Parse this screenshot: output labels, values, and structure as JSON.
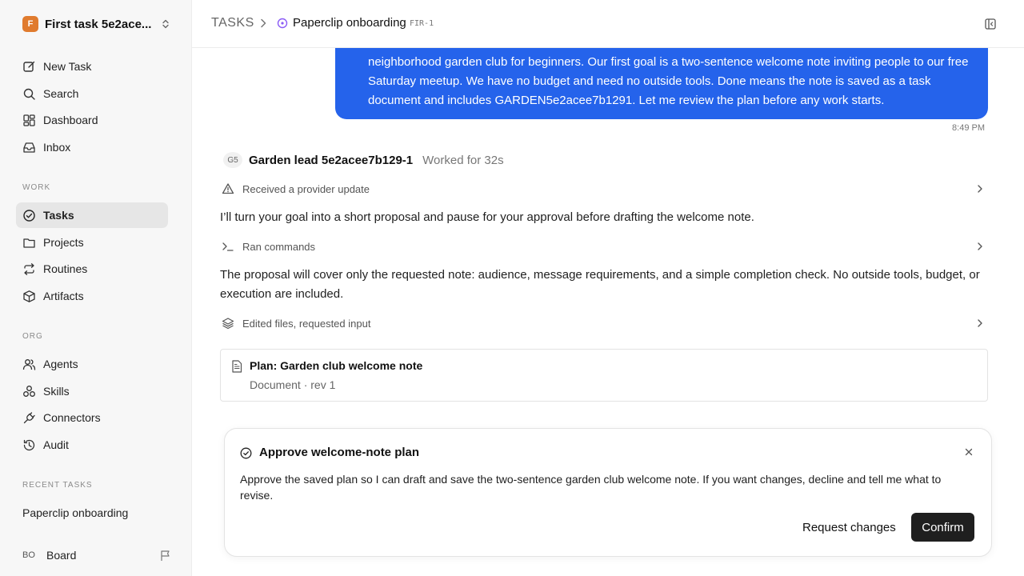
{
  "sidebar": {
    "workspace": {
      "initial": "F",
      "name": "First task 5e2ace..."
    },
    "top_items": [
      {
        "label": "New Task",
        "icon": "edit-icon"
      },
      {
        "label": "Search",
        "icon": "search-icon"
      },
      {
        "label": "Dashboard",
        "icon": "dashboard-icon"
      },
      {
        "label": "Inbox",
        "icon": "inbox-icon"
      }
    ],
    "work_label": "WORK",
    "work_items": [
      {
        "label": "Tasks",
        "icon": "check-circle-icon",
        "active": true
      },
      {
        "label": "Projects",
        "icon": "folder-icon"
      },
      {
        "label": "Routines",
        "icon": "repeat-icon"
      },
      {
        "label": "Artifacts",
        "icon": "box-icon"
      }
    ],
    "org_label": "ORG",
    "org_items": [
      {
        "label": "Agents",
        "icon": "users-icon"
      },
      {
        "label": "Skills",
        "icon": "skills-icon"
      },
      {
        "label": "Connectors",
        "icon": "plug-icon"
      },
      {
        "label": "Audit",
        "icon": "history-icon"
      }
    ],
    "recent_label": "RECENT TASKS",
    "recent_items": [
      "Paperclip onboarding"
    ],
    "footer": {
      "avatar": "BO",
      "name": "Board"
    }
  },
  "header": {
    "crumb_root": "TASKS",
    "title": "Paperclip onboarding",
    "task_id": "FIR-1"
  },
  "conversation": {
    "user_message": "neighborhood garden club for beginners. Our first goal is a two-sentence welcome note inviting people to our free Saturday meetup. We have no budget and need no outside tools. Done means the note is saved as a task document and includes GARDEN5e2acee7b1291. Let me review the plan before any work starts.",
    "time": "8:49 PM",
    "agent": {
      "avatar": "G5",
      "name": "Garden lead 5e2acee7b129-1",
      "worked": "Worked for 32s"
    },
    "activity_1": "Received a provider update",
    "message_1": "I’ll turn your goal into a short proposal and pause for your approval before drafting the welcome note.",
    "activity_2": "Ran commands",
    "message_2": "The proposal will cover only the requested note: audience, message requirements, and a simple completion check. No outside tools, budget, or execution are included.",
    "activity_3": "Edited files, requested input",
    "document": {
      "title": "Plan: Garden club welcome note",
      "meta": "Document · rev 1"
    }
  },
  "approval": {
    "title": "Approve welcome-note plan",
    "text": "Approve the saved plan so I can draft and save the two-sentence garden club welcome note. If you want changes, decline and tell me what to revise.",
    "secondary_label": "Request changes",
    "primary_label": "Confirm"
  },
  "colors": {
    "accent": "#2563eb",
    "primary_button": "#1f1f1f",
    "active_nav": "#e6e6e6",
    "crumb_icon": "#8b5cf6"
  }
}
